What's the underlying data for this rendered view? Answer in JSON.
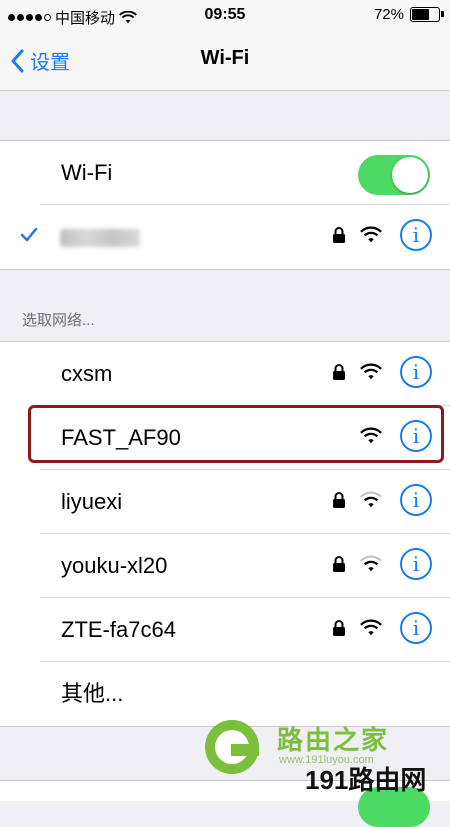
{
  "status_bar": {
    "carrier": "中国移动",
    "time": "09:55",
    "battery": "72%",
    "battery_level": 0.72,
    "signal_bars": 4
  },
  "nav": {
    "back_label": "设置",
    "title": "Wi-Fi"
  },
  "wifi_toggle": {
    "label": "Wi-Fi",
    "enabled": true
  },
  "connected_network": {
    "name_obscured": true,
    "secured": true
  },
  "section_header": "选取网络...",
  "networks": [
    {
      "name": "cxsm",
      "secured": true,
      "signal": "full"
    },
    {
      "name": "FAST_AF90",
      "secured": false,
      "signal": "full",
      "highlighted": true
    },
    {
      "name": "liyuexi",
      "secured": true,
      "signal": "weak"
    },
    {
      "name": "youku-xl20",
      "secured": true,
      "signal": "weak"
    },
    {
      "name": "ZTE-fa7c64",
      "secured": true,
      "signal": "full"
    }
  ],
  "other_label": "其他...",
  "watermark": {
    "name": "路由之家",
    "url": "www.191luyou.com",
    "brand": "191路由网"
  },
  "colors": {
    "accent": "#1a7cf5",
    "toggle_on": "#4cd964",
    "highlight_border": "#8b1a1a",
    "watermark_green": "#7bbf3c"
  }
}
